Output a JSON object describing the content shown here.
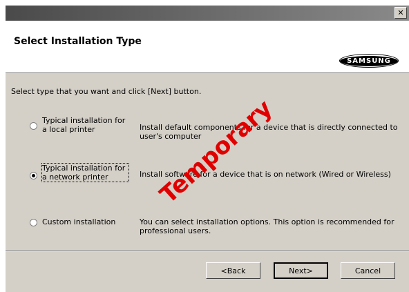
{
  "window": {
    "close_glyph": "✕"
  },
  "header": {
    "title": "Select Installation Type",
    "logo_text": "SAMSUNG"
  },
  "instruction": "Select type that you want and click [Next] button.",
  "options": [
    {
      "label": "Typical installation for a local printer",
      "description": "Install default components for a device that is directly connected to user's computer",
      "selected": false
    },
    {
      "label": "Typical installation for a network printer",
      "description": "Install software for a device that is on network (Wired or Wireless)",
      "selected": true
    },
    {
      "label": "Custom installation",
      "description": "You can select installation options. This option is recommended for professional users.",
      "selected": false
    }
  ],
  "buttons": {
    "back": "<Back",
    "next": "Next>",
    "cancel": "Cancel"
  },
  "watermark": {
    "text": "Temporary",
    "color": "#e00000"
  }
}
